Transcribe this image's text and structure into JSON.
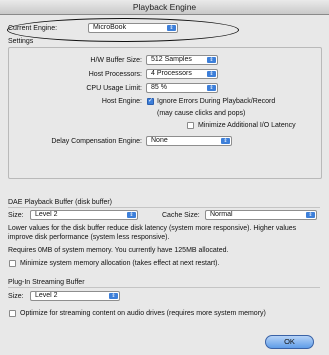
{
  "window": {
    "title": "Playback Engine"
  },
  "engine": {
    "label": "Current Engine:",
    "value": "MicroBook"
  },
  "settings": {
    "header": "Settings",
    "hw_buffer": {
      "label": "H/W Buffer Size:",
      "value": "512 Samples"
    },
    "host_processors": {
      "label": "Host Processors:",
      "value": "4 Processors"
    },
    "cpu_limit": {
      "label": "CPU Usage Limit:",
      "value": "85 %"
    },
    "host_engine": {
      "label": "Host Engine:",
      "ignore_errors": "Ignore Errors During Playback/Record",
      "ignore_errors_note": "(may cause clicks and pops)",
      "minimize_latency": "Minimize Additional I/O Latency"
    },
    "delay_comp": {
      "label": "Delay Compensation Engine:",
      "value": "None"
    }
  },
  "dae": {
    "header": "DAE Playback Buffer (disk buffer)",
    "size_label": "Size:",
    "size_value": "Level 2",
    "cache_label": "Cache Size:",
    "cache_value": "Normal",
    "note": "Lower values for the disk buffer reduce disk latency (system more responsive). Higher values improve disk performance (system less responsive).",
    "memory_note": "Requires 0MB of system memory. You currently have 125MB allocated.",
    "minimize_alloc": "Minimize system memory allocation (takes effect at next restart)."
  },
  "plugin": {
    "header": "Plug-In Streaming Buffer",
    "size_label": "Size:",
    "size_value": "Level 2",
    "optimize": "Optimize for streaming content on audio drives (requires more system memory)"
  },
  "ok_label": "OK",
  "colors": {
    "accent": "#3d7fd9"
  }
}
